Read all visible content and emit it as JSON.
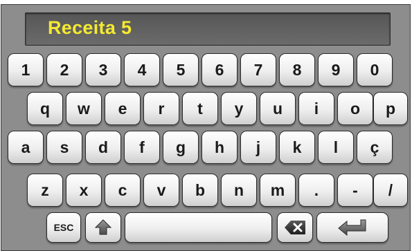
{
  "display": {
    "text": "Receita 5"
  },
  "rows": [
    [
      "1",
      "2",
      "3",
      "4",
      "5",
      "6",
      "7",
      "8",
      "9",
      "0"
    ],
    [
      "q",
      "w",
      "e",
      "r",
      "t",
      "y",
      "u",
      "i",
      "o",
      "p"
    ],
    [
      "a",
      "s",
      "d",
      "f",
      "g",
      "h",
      "j",
      "k",
      "l",
      "ç"
    ],
    [
      "z",
      "x",
      "c",
      "v",
      "b",
      "n",
      "m",
      ".",
      "-",
      "/"
    ]
  ],
  "special_keys": {
    "esc_label": "ESC",
    "shift_icon": "shift-up-arrow-icon",
    "space_label": "",
    "backspace_icon": "backspace-x-icon",
    "enter_icon": "enter-return-arrow-icon"
  },
  "colors": {
    "panel": "#8d8d8d",
    "display_bg": "#616161",
    "display_text": "#f5ea2f",
    "key_face": "#f2f2f2"
  }
}
